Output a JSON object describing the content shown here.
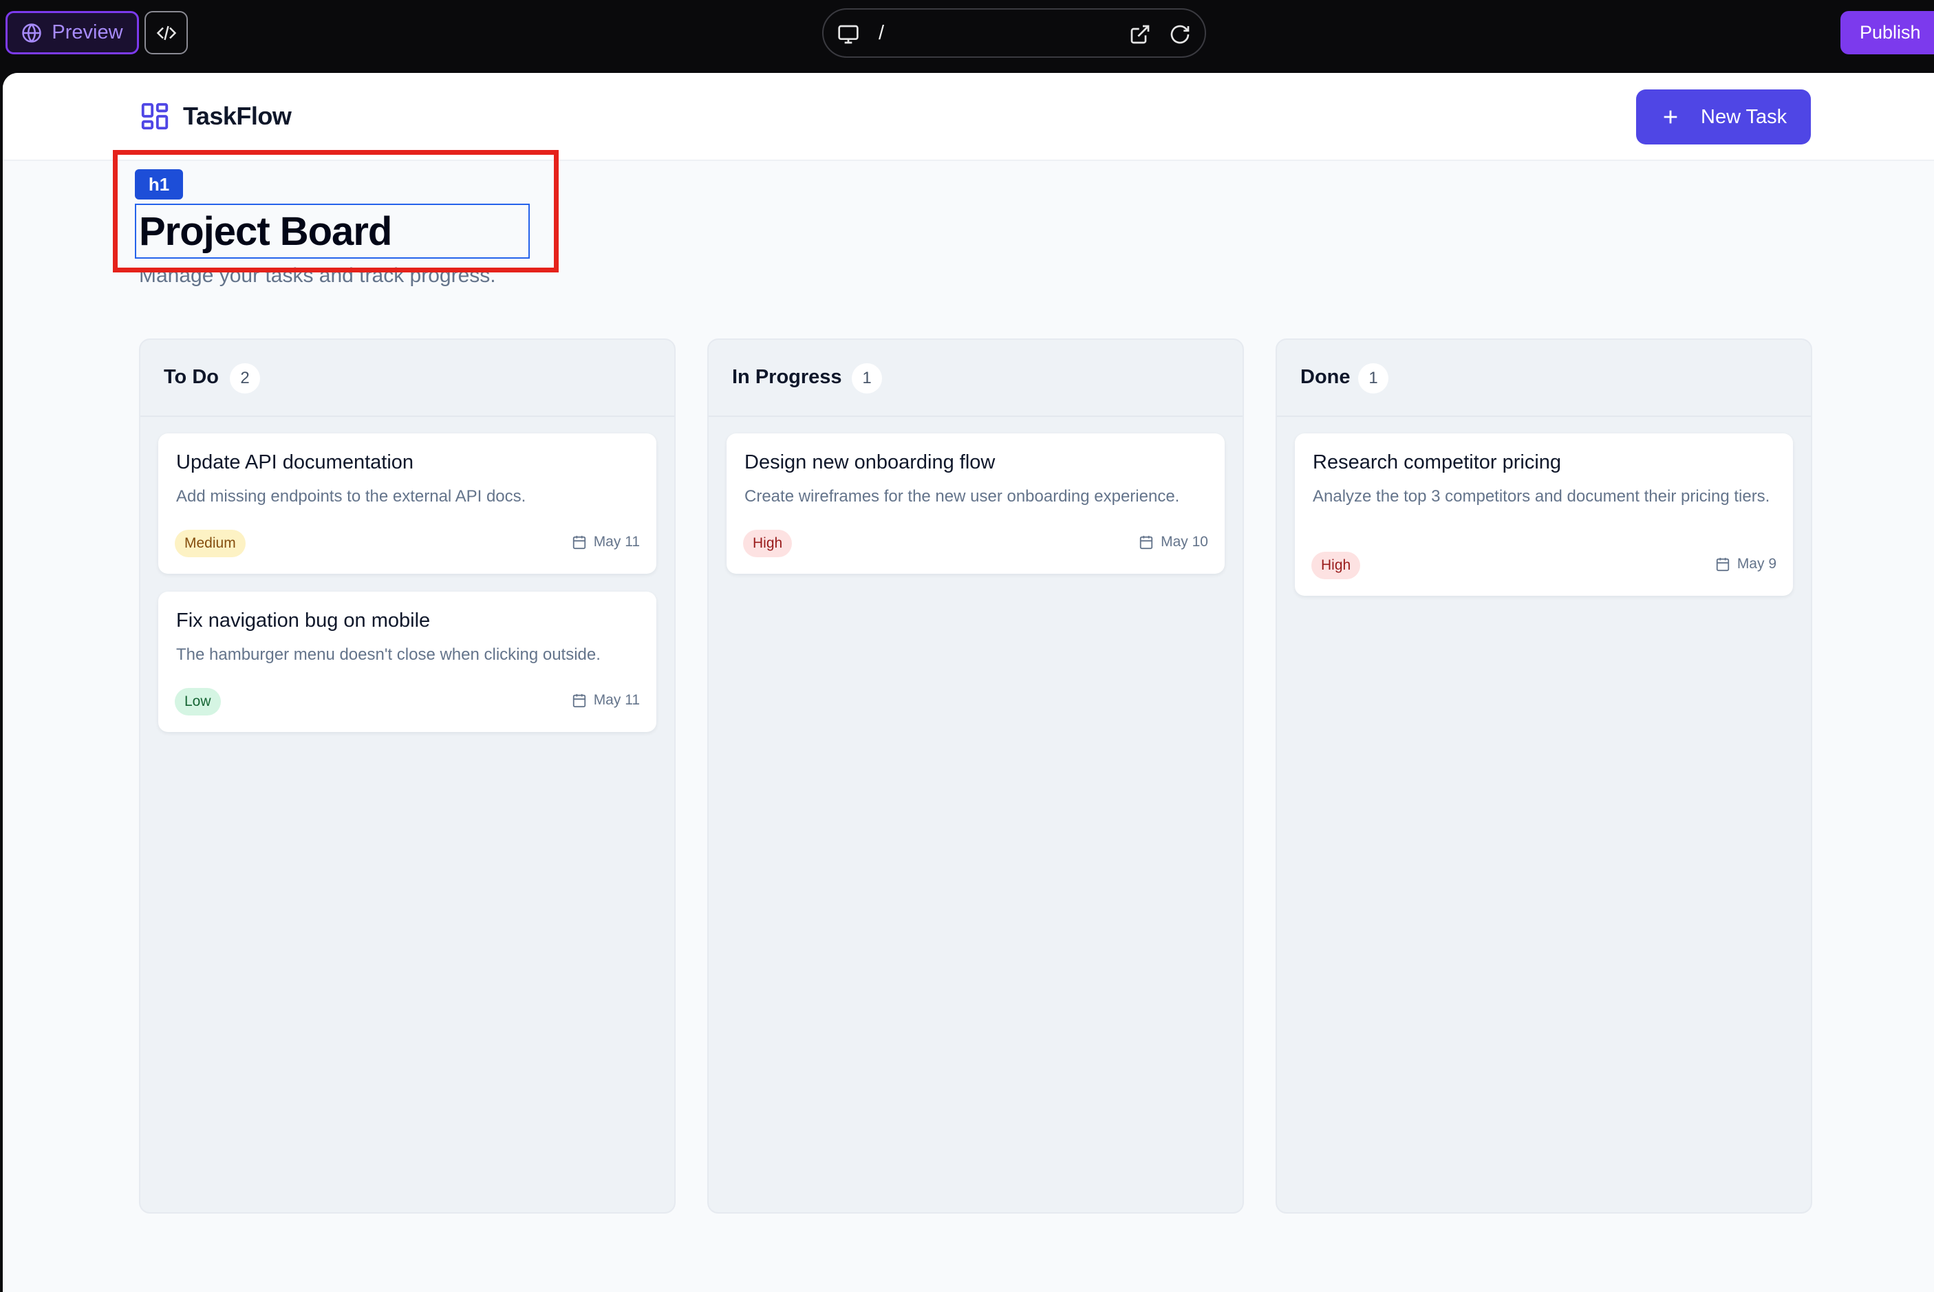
{
  "toolbar": {
    "preview_label": "Preview",
    "url_path": "/",
    "publish_label": "Publish"
  },
  "app": {
    "logo_text": "TaskFlow",
    "new_task_label": "New Task",
    "page_title": "Project Board",
    "page_subtitle": "Manage your tasks and track progress.",
    "selected_tag": "h1"
  },
  "columns": [
    {
      "title": "To Do",
      "count": "2",
      "cards": [
        {
          "title": "Update API documentation",
          "desc": "Add missing endpoints to the external API docs.",
          "priority": "Medium",
          "date": "May 11"
        },
        {
          "title": "Fix navigation bug on mobile",
          "desc": "The hamburger menu doesn't close when clicking outside.",
          "priority": "Low",
          "date": "May 11"
        }
      ]
    },
    {
      "title": "In Progress",
      "count": "1",
      "cards": [
        {
          "title": "Design new onboarding flow",
          "desc": "Create wireframes for the new user onboarding experience.",
          "priority": "High",
          "date": "May 10"
        }
      ]
    },
    {
      "title": "Done",
      "count": "1",
      "cards": [
        {
          "title": "Research competitor pricing",
          "desc": "Analyze the top 3 competitors and document their pricing tiers.",
          "priority": "High",
          "date": "May 9"
        }
      ]
    }
  ],
  "colors": {
    "accent": "#4f46e5",
    "publish": "#7c3aed",
    "selection": "#2563eb",
    "highlight": "#e5221b"
  }
}
